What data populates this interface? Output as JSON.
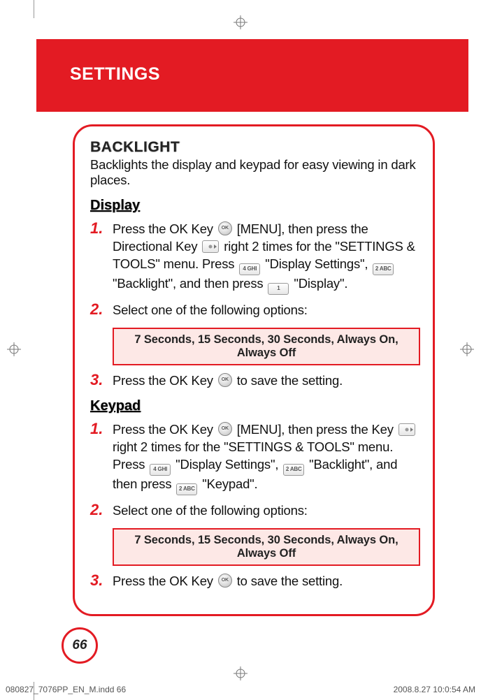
{
  "header": {
    "title": "SETTINGS"
  },
  "section": {
    "title": "BACKLIGHT",
    "subtitle": "Backlights the display and keypad for easy viewing in dark places."
  },
  "display": {
    "heading": "Display",
    "step1_a": "Press the OK Key ",
    "step1_b": " [MENU], then press the Directional Key ",
    "step1_c": " right 2 times for the \"SETTINGS & TOOLS\" menu. Press ",
    "step1_d": " \"Display Settings\", ",
    "step1_e": " \"Backlight\", and then press ",
    "step1_f": " \"Display\".",
    "step2": "Select one of the following options:",
    "options": "7 Seconds, 15 Seconds, 30 Seconds, Always On, Always Off",
    "step3_a": "Press the OK Key ",
    "step3_b": " to save the setting."
  },
  "keypad": {
    "heading": "Keypad",
    "step1_a": "Press the OK Key ",
    "step1_b": " [MENU], then press the Key ",
    "step1_c": " right 2 times for the \"SETTINGS & TOOLS\" menu. Press ",
    "step1_d": " \"Display Settings\", ",
    "step1_e": " \"Backlight\", and then press ",
    "step1_f": " \"Keypad\".",
    "step2": "Select one of the following options:",
    "options": "7 Seconds, 15 Seconds, 30 Seconds, Always On, Always Off",
    "step3_a": "Press the OK Key ",
    "step3_b": " to save the setting."
  },
  "nums": {
    "n1": "1.",
    "n2": "2.",
    "n3": "3."
  },
  "keys": {
    "k4": "4 GHI",
    "k2": "2 ABC",
    "k1": "1"
  },
  "page_number": "66",
  "footer": {
    "left": "080827_7076PP_EN_M.indd   66",
    "right": "2008.8.27   10:0:54 AM"
  }
}
